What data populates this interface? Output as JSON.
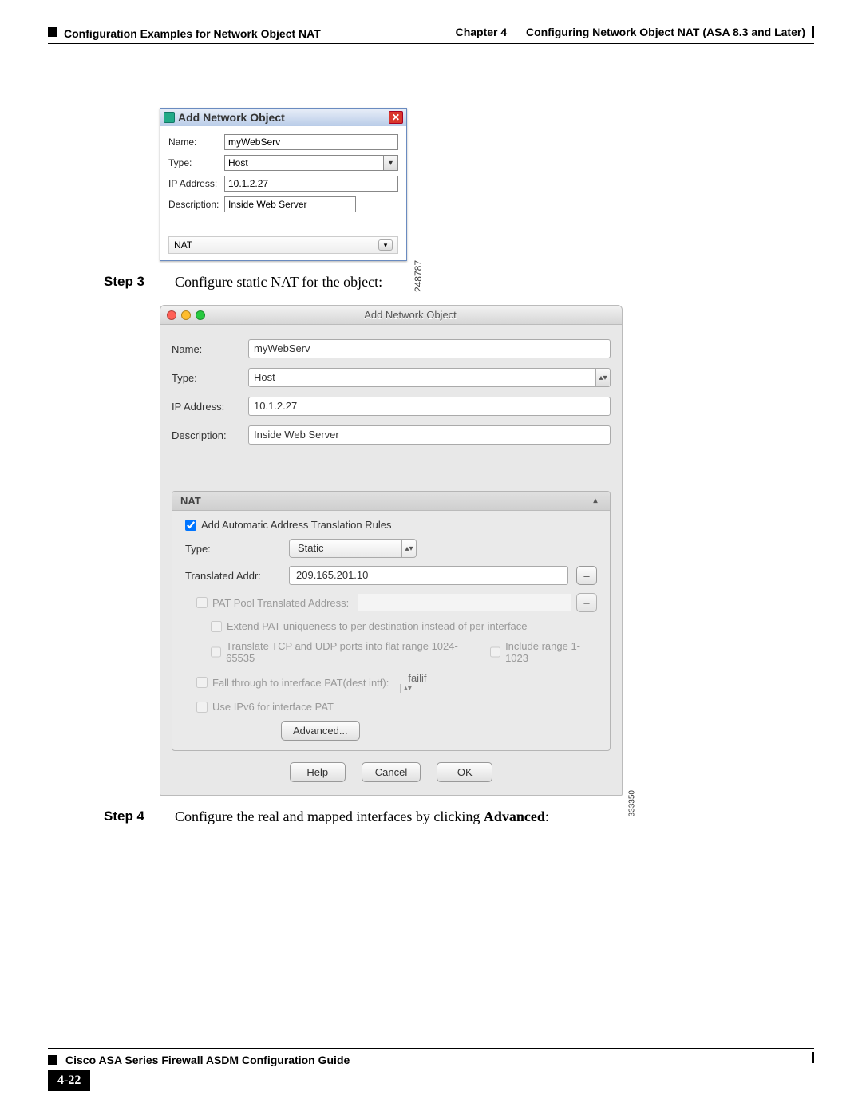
{
  "header": {
    "chapter_label": "Chapter 4",
    "chapter_title": "Configuring Network Object NAT (ASA 8.3 and Later)",
    "section": "Configuration Examples for Network Object NAT"
  },
  "step3": {
    "label": "Step 3",
    "text": "Configure static NAT for the object:"
  },
  "step4": {
    "label": "Step 4",
    "text_prefix": "Configure the real and mapped interfaces by clicking ",
    "text_bold": "Advanced",
    "text_suffix": ":"
  },
  "dialog1": {
    "title": "Add Network Object",
    "side_code": "248787",
    "fields": {
      "name_label": "Name:",
      "name_value": "myWebServ",
      "type_label": "Type:",
      "type_value": "Host",
      "ip_label": "IP Address:",
      "ip_value": "10.1.2.27",
      "desc_label": "Description:",
      "desc_value": "Inside Web Server"
    },
    "nat_label": "NAT"
  },
  "dialog2": {
    "title": "Add Network Object",
    "side_code": "333350",
    "fields": {
      "name_label": "Name:",
      "name_value": "myWebServ",
      "type_label": "Type:",
      "type_value": "Host",
      "ip_label": "IP Address:",
      "ip_value": "10.1.2.27",
      "desc_label": "Description:",
      "desc_value": "Inside Web Server"
    },
    "nat": {
      "panel_title": "NAT",
      "add_rules": "Add Automatic Address Translation Rules",
      "type_label": "Type:",
      "type_value": "Static",
      "trans_label": "Translated Addr:",
      "trans_value": "209.165.201.10",
      "pat_pool": "PAT Pool Translated Address:",
      "extend_pat": "Extend PAT uniqueness to per destination instead of per interface",
      "flat_range": "Translate TCP and UDP ports into flat range 1024-65535",
      "include_range": "Include range 1-1023",
      "fall_through": "Fall through to interface PAT(dest intf):",
      "fall_through_value": "failif",
      "use_ipv6": "Use IPv6 for interface PAT",
      "advanced": "Advanced..."
    },
    "buttons": {
      "help": "Help",
      "cancel": "Cancel",
      "ok": "OK"
    }
  },
  "footer": {
    "pagenum": "4-22",
    "guide": "Cisco ASA Series Firewall ASDM Configuration Guide"
  }
}
